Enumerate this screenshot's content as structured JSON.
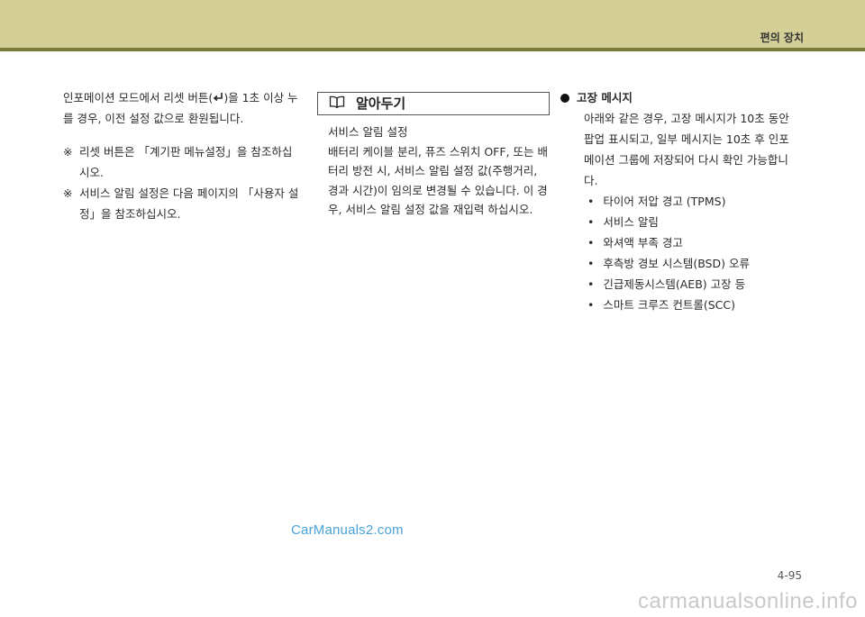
{
  "header": {
    "section_title": "편의 장치"
  },
  "left": {
    "intro_before_icon": "인포메이션 모드에서 리셋 버튼(",
    "intro_after_icon": ")을 1초 이상 누를 경우, 이전 설정 값으로 환원됩니다.",
    "notes": [
      {
        "mark": "※",
        "text": "리셋 버튼은 「계기판 메뉴설정」을 참조하십시오."
      },
      {
        "mark": "※",
        "text": "서비스 알림 설정은 다음 페이지의 「사용자 설정」을 참조하십시오."
      }
    ]
  },
  "tip": {
    "title": "알아두기",
    "icon": "open-book-icon",
    "heading": "서비스 알림 설정",
    "body": "배터리 케이블 분리, 퓨즈 스위치 OFF, 또는 배터리 방전 시, 서비스 알림 설정 값(주행거리, 경과 시간)이 임의로 변경될 수 있습니다. 이 경우, 서비스 알림 설정 값을 재입력 하십시오."
  },
  "right": {
    "heading": "고장 메시지",
    "description": "아래와 같은 경우, 고장 메시지가 10초 동안 팝업 표시되고, 일부 메시지는 10초 후 인포메이션 그룹에 저장되어 다시 확인 가능합니다.",
    "items": [
      "타이어 저압 경고 (TPMS)",
      "서비스 알림",
      "와셔액 부족 경고",
      "후측방 경보 시스템(BSD) 오류",
      "긴급제동시스템(AEB) 고장 등",
      "스마트 크루즈 컨트롤(SCC)"
    ]
  },
  "watermark": "CarManuals2.com",
  "page_number": "4-95",
  "footer_watermark": "carmanualsonline.info",
  "colors": {
    "header": "#d3cf97",
    "header_rule": "#7a7b3a",
    "watermark": "#4aa3d8"
  }
}
